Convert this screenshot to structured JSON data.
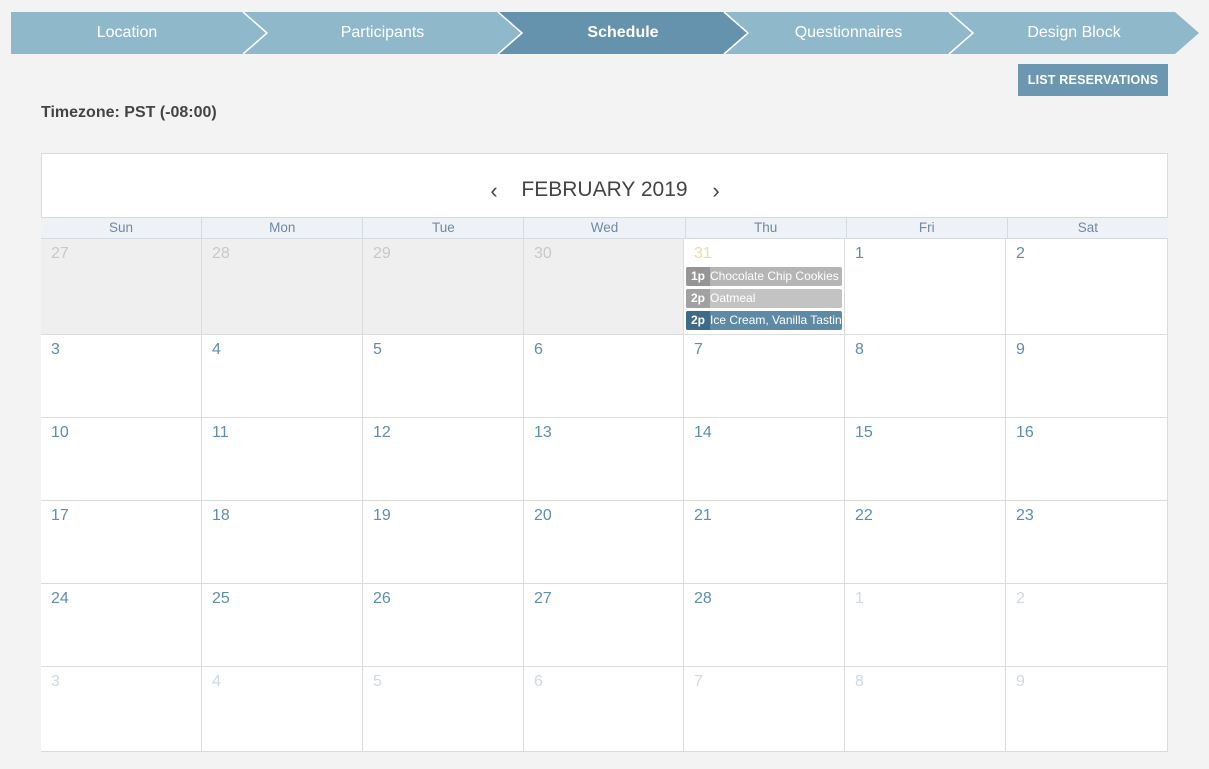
{
  "wizard": {
    "steps": [
      {
        "label": "Location",
        "active": false
      },
      {
        "label": "Participants",
        "active": false
      },
      {
        "label": "Schedule",
        "active": true
      },
      {
        "label": "Questionnaires",
        "active": false
      },
      {
        "label": "Design Block",
        "active": false
      }
    ],
    "colors": {
      "inactive": "#8fb9cb",
      "active": "#6593ad"
    }
  },
  "actions": {
    "list_reservations": "LIST RESERVATIONS"
  },
  "timezone": "Timezone: PST (-08:00)",
  "calendar": {
    "month_title": "FEBRUARY 2019",
    "prev_icon": "chevron-left-icon",
    "next_icon": "chevron-right-icon",
    "prev_glyph": "‹",
    "next_glyph": "›",
    "weekdays": [
      "Sun",
      "Mon",
      "Tue",
      "Wed",
      "Thu",
      "Fri",
      "Sat"
    ],
    "weeks": [
      [
        {
          "day": "27",
          "kind": "prev-past"
        },
        {
          "day": "28",
          "kind": "prev-past"
        },
        {
          "day": "29",
          "kind": "prev-past"
        },
        {
          "day": "30",
          "kind": "prev-past"
        },
        {
          "day": "31",
          "kind": "today",
          "events": [
            {
              "time": "1p",
              "title": "Chocolate Chip Cookies",
              "style": "gray1"
            },
            {
              "time": "2p",
              "title": "Oatmeal",
              "style": "gray2"
            },
            {
              "time": "2p",
              "title": "Ice Cream, Vanilla Tasting",
              "style": "blue"
            }
          ]
        },
        {
          "day": "1",
          "kind": "current"
        },
        {
          "day": "2",
          "kind": "current"
        }
      ],
      [
        {
          "day": "3",
          "kind": "current"
        },
        {
          "day": "4",
          "kind": "current"
        },
        {
          "day": "5",
          "kind": "current"
        },
        {
          "day": "6",
          "kind": "current"
        },
        {
          "day": "7",
          "kind": "current"
        },
        {
          "day": "8",
          "kind": "current"
        },
        {
          "day": "9",
          "kind": "current"
        }
      ],
      [
        {
          "day": "10",
          "kind": "current"
        },
        {
          "day": "11",
          "kind": "current"
        },
        {
          "day": "12",
          "kind": "current"
        },
        {
          "day": "13",
          "kind": "current"
        },
        {
          "day": "14",
          "kind": "current"
        },
        {
          "day": "15",
          "kind": "current"
        },
        {
          "day": "16",
          "kind": "current"
        }
      ],
      [
        {
          "day": "17",
          "kind": "current"
        },
        {
          "day": "18",
          "kind": "current"
        },
        {
          "day": "19",
          "kind": "current"
        },
        {
          "day": "20",
          "kind": "current"
        },
        {
          "day": "21",
          "kind": "current"
        },
        {
          "day": "22",
          "kind": "current"
        },
        {
          "day": "23",
          "kind": "current"
        }
      ],
      [
        {
          "day": "24",
          "kind": "current"
        },
        {
          "day": "25",
          "kind": "current"
        },
        {
          "day": "26",
          "kind": "current"
        },
        {
          "day": "27",
          "kind": "current"
        },
        {
          "day": "28",
          "kind": "current"
        },
        {
          "day": "1",
          "kind": "next"
        },
        {
          "day": "2",
          "kind": "next"
        }
      ],
      [
        {
          "day": "3",
          "kind": "next"
        },
        {
          "day": "4",
          "kind": "next"
        },
        {
          "day": "5",
          "kind": "next"
        },
        {
          "day": "6",
          "kind": "next"
        },
        {
          "day": "7",
          "kind": "next"
        },
        {
          "day": "8",
          "kind": "next"
        },
        {
          "day": "9",
          "kind": "next"
        }
      ]
    ]
  }
}
